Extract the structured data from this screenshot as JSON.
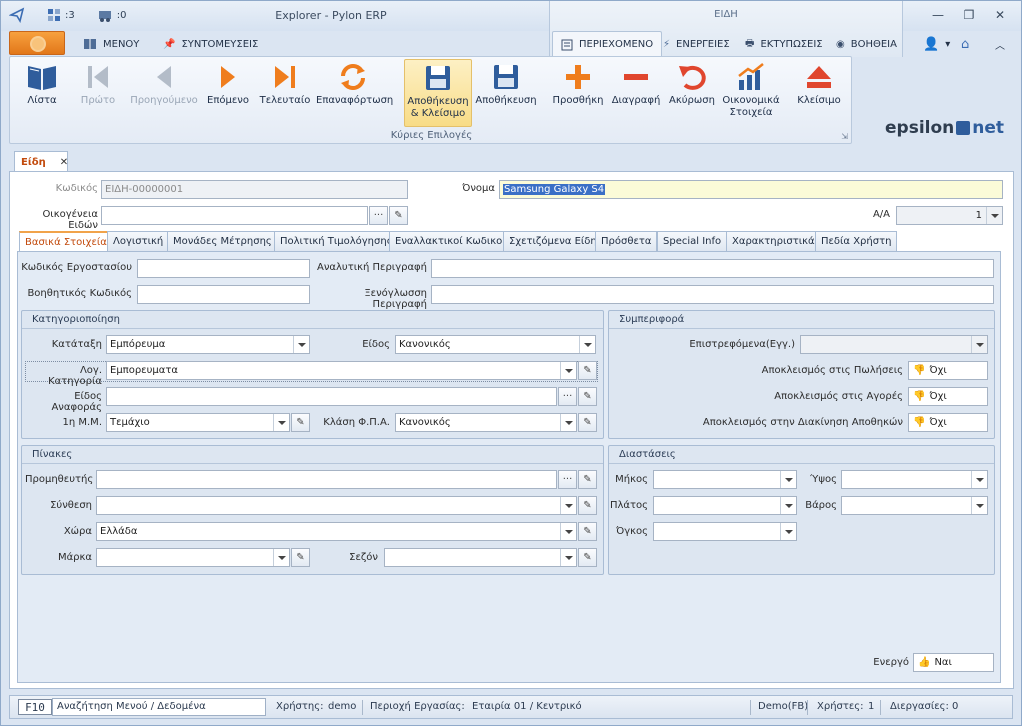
{
  "window": {
    "title": "Explorer - Pylon ERP",
    "context_title": "ΕΙΔΗ",
    "qat_count1": ":3",
    "qat_count2": ":0"
  },
  "ribbon_tabs": [
    "ΜΕΝΟΥ",
    "ΣΥΝΤΟΜΕΥΣΕΙΣ",
    "ΠΕΡΙΕΧΟΜΕΝΟ",
    "ΕΝΕΡΓΕΙΕΣ",
    "ΕΚΤΥΠΩΣΕΙΣ",
    "ΒΟΗΘΕΙΑ"
  ],
  "ribbon": {
    "buttons": [
      "Λίστα",
      "Πρώτο",
      "Προηγούμενο",
      "Επόμενο",
      "Τελευταίο",
      "Επαναφόρτωση",
      "Αποθήκευση & Κλείσιμο",
      "Αποθήκευση",
      "Προσθήκη",
      "Διαγραφή",
      "Ακύρωση",
      "Οικονομικά Στοιχεία",
      "Κλείσιμο"
    ],
    "group_label": "Κύριες Επιλογές",
    "logo_a": "epsilon",
    "logo_b": "net"
  },
  "doc_tab": "Είδη",
  "header": {
    "code_label": "Κωδικός",
    "code_value": "ΕΙΔΗ-00000001",
    "name_label": "Όνομα",
    "name_value": "Samsung Galaxy S4",
    "family_label": "Οικογένεια Ειδών",
    "family_value": "",
    "aa_label": "Α/Α",
    "aa_value": "1"
  },
  "tabs": [
    "Βασικά Στοιχεία",
    "Λογιστική",
    "Μονάδες Μέτρησης",
    "Πολιτική Τιμολόγησης",
    "Εναλλακτικοί Κωδικοί",
    "Σχετιζόμενα Είδη",
    "Πρόσθετα",
    "Special Info",
    "Χαρακτηριστικά",
    "Πεδία Χρήστη"
  ],
  "basic": {
    "factory_code": "Κωδικός Εργοστασίου",
    "aux_code": "Βοηθητικός Κωδικός",
    "desc": "Αναλυτική Περιγραφή",
    "foreign_desc": "Ξενόγλωσση Περιγραφή"
  },
  "category": {
    "title": "Κατηγοριοποίηση",
    "katataxi": "Κατάταξη",
    "katataxi_val": "Εμπόρευμα",
    "eidos": "Είδος",
    "eidos_val": "Κανονικός",
    "log_cat": "Λογ. Κατηγορία",
    "log_cat_val": "Εμπορευματα",
    "ref_type": "Είδος Αναφοράς",
    "mm": "1η Μ.Μ.",
    "mm_val": "Τεμάχιο",
    "vat": "Κλάση Φ.Π.Α.",
    "vat_val": "Κανονικός"
  },
  "behavior": {
    "title": "Συμπεριφορά",
    "returnable": "Επιστρεφόμενα(Εγγ.)",
    "ex_sales": "Αποκλεισμός στις Πωλήσεις",
    "ex_buys": "Αποκλεισμός στις Αγορές",
    "ex_wh": "Αποκλεισμός στην Διακίνηση Αποθηκών",
    "no": "Όχι"
  },
  "tables": {
    "title": "Πίνακες",
    "supplier": "Προμηθευτής",
    "composition": "Σύνθεση",
    "country": "Χώρα",
    "country_val": "Ελλάδα",
    "brand": "Μάρκα",
    "season": "Σεζόν"
  },
  "dims": {
    "title": "Διαστάσεις",
    "length": "Μήκος",
    "height": "Ύψος",
    "width": "Πλάτος",
    "weight": "Βάρος",
    "volume": "Όγκος"
  },
  "active": {
    "label": "Ενεργό",
    "value": "Ναι"
  },
  "status": {
    "f10": "F10",
    "search": "Αναζήτηση Μενού / Δεδομένα",
    "user_label": "Χρήστης:",
    "user": "demo",
    "area_label": "Περιοχή Εργασίας:",
    "area": "Εταιρία 01 / Κεντρικό",
    "db": "Demo(FB)",
    "users_label": "Χρήστες:",
    "users": "1",
    "proc_label": "Διεργασίες:",
    "proc": "0"
  },
  "colors": {
    "accent": "#e2771a",
    "selection": "#3a6fc6",
    "frame": "#a9bcd4"
  }
}
